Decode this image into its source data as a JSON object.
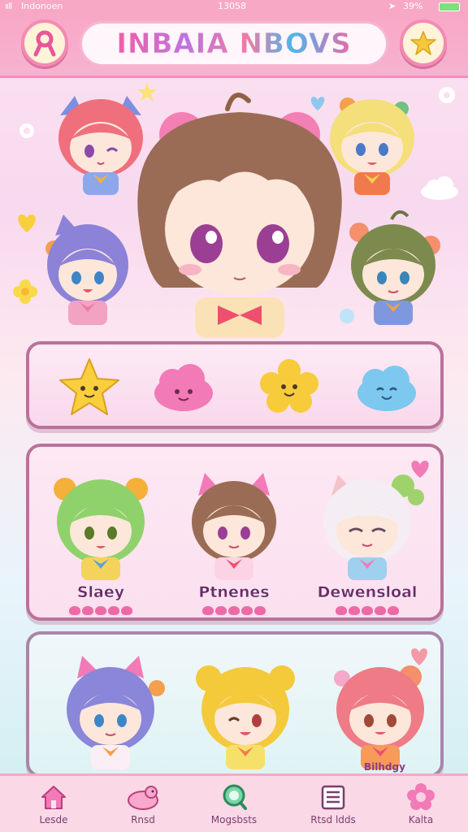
{
  "status_bar": {
    "signal": "ııll",
    "carrier": "Indonoen",
    "time": "13058",
    "battery": "39%"
  },
  "header": {
    "title": "INBAIA NBOVS",
    "left_icon": "ribbon-icon",
    "right_icon": "star-icon"
  },
  "hero": {
    "characters": [
      {
        "hair": "#ef6f7d",
        "accent": "#7c8fe0",
        "eyes": "closed-wink"
      },
      {
        "hair": "#f4df7a",
        "accent": "#6fc27f",
        "eyes": "open"
      },
      {
        "hair": "#8c82d8",
        "accent": "#f2a3c2",
        "eyes": "open"
      },
      {
        "hair": "#b07a52",
        "accent": "#f28bb0",
        "eyes": "open"
      },
      {
        "hair": "#7c8a4e",
        "accent": "#f58f6c",
        "eyes": "open"
      }
    ]
  },
  "emotes": [
    {
      "icon": "star-face-icon",
      "color": "#f9cf3e"
    },
    {
      "icon": "pink-cloud-face-icon",
      "color": "#f27ab7"
    },
    {
      "icon": "yellow-flower-face-icon",
      "color": "#f8cb3a"
    },
    {
      "icon": "blue-cloud-face-icon",
      "color": "#7cc8ef"
    }
  ],
  "friends": [
    {
      "name": "Slaey",
      "hair": "#8fd26b"
    },
    {
      "name": "Ptnenes",
      "hair": "#9b6c55"
    },
    {
      "name": "Dewensloal",
      "hair": "#f4eef4"
    }
  ],
  "more_characters": [
    {
      "hair": "#8a86d9"
    },
    {
      "hair": "#f4c93a"
    },
    {
      "hair": "#ee7b86"
    }
  ],
  "more_label": "Bilhdgy",
  "nav": [
    {
      "label": "Lesde",
      "icon": "home-icon"
    },
    {
      "label": "Rnsd",
      "icon": "pet-icon"
    },
    {
      "label": "Mogsbsts",
      "icon": "search-icon"
    },
    {
      "label": "Rtsd ldds",
      "icon": "list-icon"
    },
    {
      "label": "Kalta",
      "icon": "flower-icon"
    }
  ],
  "colors": {
    "header_pink": "#f8a7c6",
    "panel_border": "#b9729a",
    "title_gradient": [
      "#f05ea7",
      "#c073e0",
      "#4fb4e8"
    ]
  }
}
